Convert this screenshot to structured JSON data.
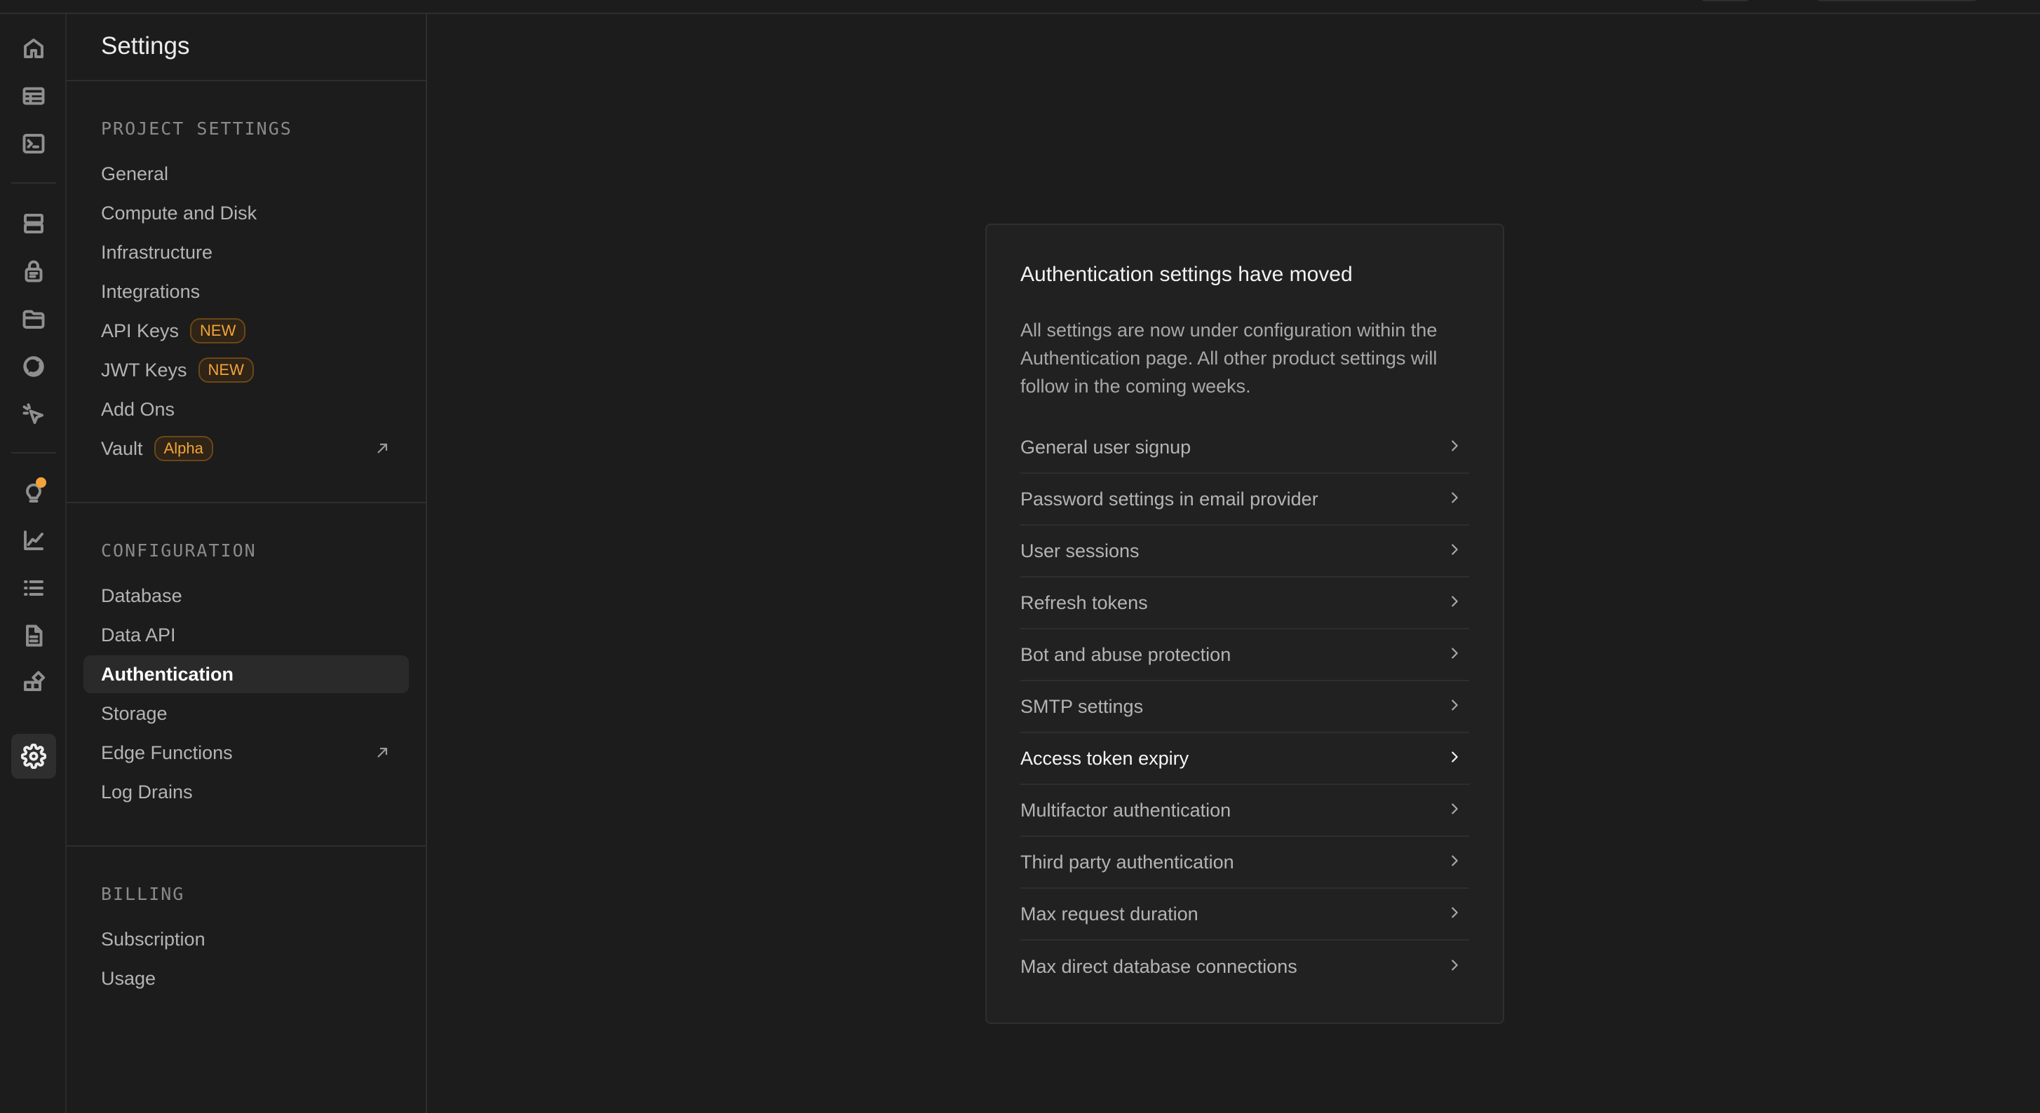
{
  "settings": {
    "title": "Settings",
    "project_settings": {
      "heading": "PROJECT SETTINGS",
      "items": [
        {
          "label": "General"
        },
        {
          "label": "Compute and Disk"
        },
        {
          "label": "Infrastructure"
        },
        {
          "label": "Integrations"
        },
        {
          "label": "API Keys",
          "badge": "NEW"
        },
        {
          "label": "JWT Keys",
          "badge": "NEW"
        },
        {
          "label": "Add Ons"
        },
        {
          "label": "Vault",
          "badge": "Alpha"
        }
      ]
    },
    "configuration": {
      "heading": "CONFIGURATION",
      "items": [
        {
          "label": "Database"
        },
        {
          "label": "Data API"
        },
        {
          "label": "Authentication"
        },
        {
          "label": "Storage"
        },
        {
          "label": "Edge Functions"
        },
        {
          "label": "Log Drains"
        }
      ]
    },
    "billing": {
      "heading": "BILLING",
      "items": [
        {
          "label": "Subscription"
        },
        {
          "label": "Usage"
        }
      ]
    }
  },
  "card": {
    "title": "Authentication settings have moved",
    "description": "All settings are now under configuration within the Authentication page. All other product settings will follow in the coming weeks.",
    "links": [
      {
        "label": "General user signup"
      },
      {
        "label": "Password settings in email provider"
      },
      {
        "label": "User sessions"
      },
      {
        "label": "Refresh tokens"
      },
      {
        "label": "Bot and abuse protection"
      },
      {
        "label": "SMTP settings"
      },
      {
        "label": "Access token expiry"
      },
      {
        "label": "Multifactor authentication"
      },
      {
        "label": "Third party authentication"
      },
      {
        "label": "Max request duration"
      },
      {
        "label": "Max direct database connections"
      }
    ]
  },
  "rail_icons": [
    "home-icon",
    "table-editor-icon",
    "sql-editor-icon",
    "database-icon",
    "authentication-icon",
    "storage-icon",
    "realtime-icon",
    "edge-functions-icon",
    "advisors-icon",
    "reports-icon",
    "logs-icon",
    "api-docs-icon",
    "integrations-icon",
    "settings-icon"
  ],
  "colors": {
    "background": "#1c1c1c",
    "card": "#212121",
    "badge": "#f3a33a",
    "notification": "#f3a33a"
  }
}
